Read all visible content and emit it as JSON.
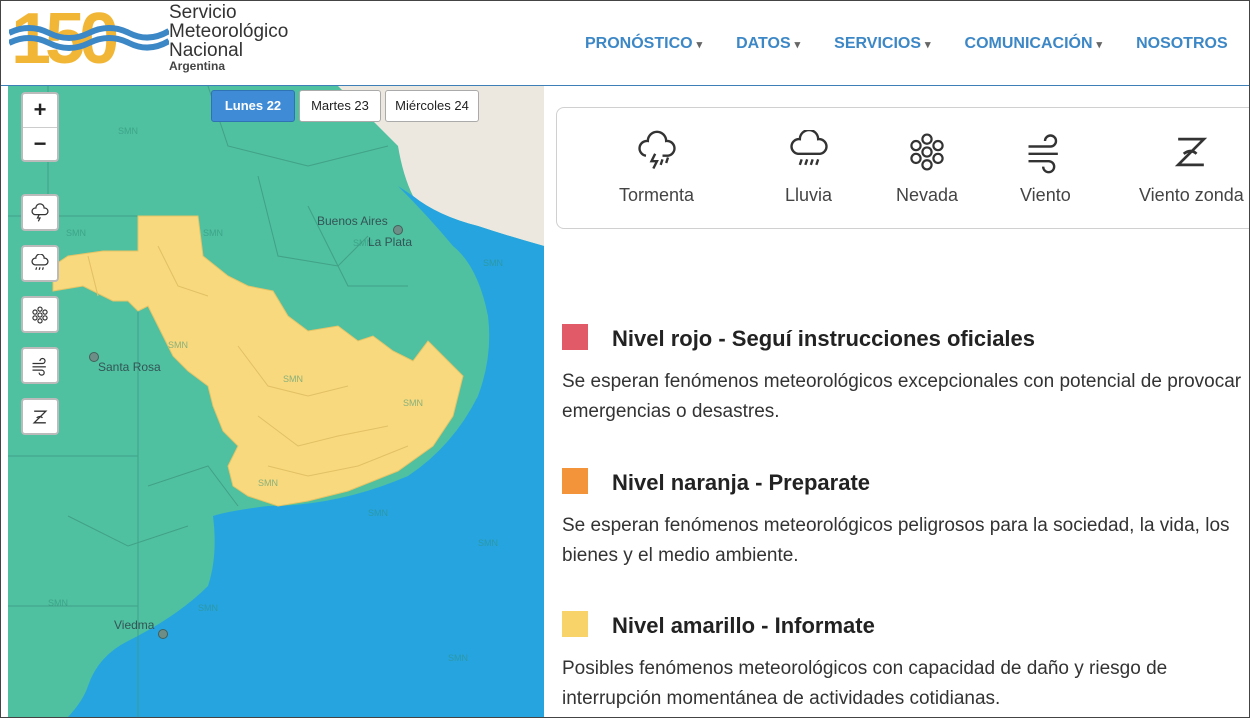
{
  "brand": {
    "anniversary": "150",
    "line1": "Servicio",
    "line2": "Meteorológico",
    "line3": "Nacional",
    "line4": "Argentina",
    "colors": {
      "gold": "#f2b637",
      "blue": "#3c87c6"
    }
  },
  "nav": {
    "items": [
      {
        "label": "PRONÓSTICO"
      },
      {
        "label": "DATOS"
      },
      {
        "label": "SERVICIOS"
      },
      {
        "label": "COMUNICACIÓN"
      },
      {
        "label": "NOSOTROS"
      }
    ],
    "caret": "▾"
  },
  "map": {
    "zoom_in": "+",
    "zoom_out": "−",
    "day_tabs": [
      "Lunes 22",
      "Martes 23",
      "Miércoles 24"
    ],
    "active_day": "Lunes 22",
    "cities": [
      "Buenos Aires",
      "La Plata",
      "Santa Rosa",
      "Viedma"
    ],
    "watermark": "SMN",
    "colors": {
      "green": "#4fc0a0",
      "yellow": "#f8d97e",
      "sea": "#26a4e0",
      "land": "#ece8e0"
    }
  },
  "phenomena": [
    {
      "label": "Tormenta",
      "icon": "thunderstorm-icon"
    },
    {
      "label": "Lluvia",
      "icon": "rain-icon"
    },
    {
      "label": "Nevada",
      "icon": "snow-icon"
    },
    {
      "label": "Viento",
      "icon": "wind-icon"
    },
    {
      "label": "Viento zonda",
      "icon": "zonda-icon"
    }
  ],
  "levels": [
    {
      "title": "Nivel rojo - Seguí instrucciones oficiales",
      "color": "#e05a67",
      "desc": "Se esperan fenómenos meteorológicos excepcionales con potencial de provocar emergencias o desastres."
    },
    {
      "title": "Nivel naranja - Preparate",
      "color": "#f4943a",
      "desc": "Se esperan fenómenos meteorológicos peligrosos para la sociedad, la vida, los bienes y el medio ambiente."
    },
    {
      "title": "Nivel amarillo - Informate",
      "color": "#f8d36a",
      "desc": "Posibles fenómenos meteorológicos con capacidad de daño y riesgo de interrupción momentánea de actividades cotidianas."
    }
  ]
}
